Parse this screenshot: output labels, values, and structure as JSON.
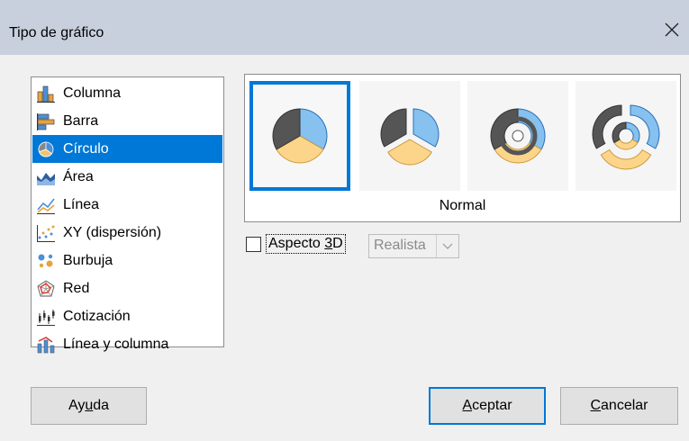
{
  "window": {
    "title": "Tipo de gráfico",
    "close_icon": "close-icon"
  },
  "chart_types": [
    {
      "label": "Columna",
      "icon": "column-chart-icon",
      "selected": false
    },
    {
      "label": "Barra",
      "icon": "bar-chart-icon",
      "selected": false
    },
    {
      "label": "Círculo",
      "icon": "pie-chart-icon",
      "selected": true
    },
    {
      "label": "Área",
      "icon": "area-chart-icon",
      "selected": false
    },
    {
      "label": "Línea",
      "icon": "line-chart-icon",
      "selected": false
    },
    {
      "label": "XY (dispersión)",
      "icon": "scatter-chart-icon",
      "selected": false
    },
    {
      "label": "Burbuja",
      "icon": "bubble-chart-icon",
      "selected": false
    },
    {
      "label": "Red",
      "icon": "net-chart-icon",
      "selected": false
    },
    {
      "label": "Cotización",
      "icon": "stock-chart-icon",
      "selected": false
    },
    {
      "label": "Línea y columna",
      "icon": "column-line-chart-icon",
      "selected": false
    }
  ],
  "variants": {
    "caption": "Normal",
    "items": [
      {
        "icon": "normal-pie-icon",
        "selected": true
      },
      {
        "icon": "exploded-pie-icon",
        "selected": false
      },
      {
        "icon": "donut-icon",
        "selected": false
      },
      {
        "icon": "exploded-donut-icon",
        "selected": false
      }
    ]
  },
  "aspect_3d": {
    "pre": "Aspecto ",
    "mnemonic": "3",
    "post": "D",
    "checked": false,
    "scheme_value": "Realista"
  },
  "buttons": {
    "help": {
      "pre": "Ay",
      "mnemonic": "u",
      "post": "da"
    },
    "ok": {
      "pre": "",
      "mnemonic": "A",
      "post": "ceptar"
    },
    "cancel": {
      "pre": "",
      "mnemonic": "C",
      "post": "ancelar"
    }
  },
  "colors": {
    "selection": "#0078d7",
    "pie_dark": "#555555",
    "pie_blue": "#86c1ef",
    "pie_yellow": "#fdd58a"
  }
}
